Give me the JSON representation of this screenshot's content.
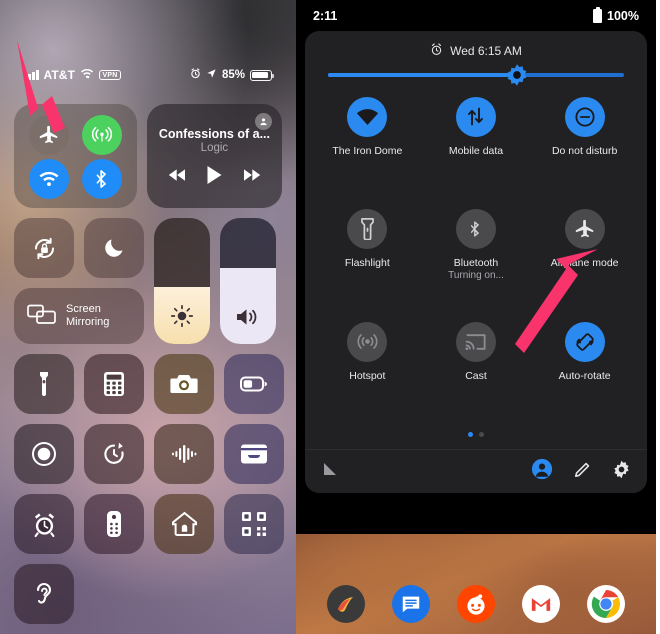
{
  "ios": {
    "status": {
      "carrier": "AT&T",
      "vpn_badge": "VPN",
      "battery_percent": "85%",
      "icons": [
        "signal-bars-icon",
        "wifi-icon",
        "vpn-badge",
        "alarm-icon",
        "location-arrow-icon",
        "battery-icon"
      ]
    },
    "connectivity": {
      "airplane_label": "airplane-mode-icon",
      "cellular_label": "cellular-data-icon",
      "wifi_label": "wifi-icon",
      "bluetooth_label": "bluetooth-icon"
    },
    "media": {
      "title": "Confessions of a...",
      "artist": "Logic",
      "airplay": "airplay-icon",
      "controls": [
        "rewind-icon",
        "play-icon",
        "fast-forward-icon"
      ]
    },
    "toggles": {
      "rotation_lock": "rotation-lock-icon",
      "do_not_disturb": "moon-icon",
      "screen_mirroring_line1": "Screen",
      "screen_mirroring_line2": "Mirroring"
    },
    "sliders": {
      "brightness_icon": "brightness-icon",
      "brightness_percent": 45,
      "volume_icon": "volume-icon",
      "volume_percent": 60
    },
    "grid_tiles": [
      {
        "name": "flashlight-icon"
      },
      {
        "name": "calculator-icon"
      },
      {
        "name": "camera-icon"
      },
      {
        "name": "low-power-mode-icon"
      },
      {
        "name": "screen-record-icon"
      },
      {
        "name": "timer-icon"
      },
      {
        "name": "sound-recognition-icon"
      },
      {
        "name": "wallet-icon"
      },
      {
        "name": "alarm-clock-icon"
      },
      {
        "name": "remote-icon"
      },
      {
        "name": "home-icon"
      },
      {
        "name": "qr-code-icon"
      },
      {
        "name": "hearing-icon"
      }
    ]
  },
  "android": {
    "status": {
      "time": "2:11",
      "battery_percent": "100%"
    },
    "alarm": {
      "icon": "alarm-icon",
      "text": "Wed 6:15 AM"
    },
    "brightness": {
      "icon": "brightness-icon",
      "percent": 64
    },
    "tiles": [
      {
        "label": "The Iron Dome",
        "sub": "",
        "icon": "wifi-icon",
        "state": "on"
      },
      {
        "label": "Mobile data",
        "sub": "",
        "icon": "mobile-data-icon",
        "state": "on"
      },
      {
        "label": "Do not disturb",
        "sub": "",
        "icon": "do-not-disturb-icon",
        "state": "on"
      },
      {
        "label": "Flashlight",
        "sub": "",
        "icon": "flashlight-icon",
        "state": "off"
      },
      {
        "label": "Bluetooth",
        "sub": "Turning on...",
        "icon": "bluetooth-icon",
        "state": "off"
      },
      {
        "label": "Airplane mode",
        "sub": "",
        "icon": "airplane-mode-icon",
        "state": "off"
      },
      {
        "label": "Hotspot",
        "sub": "",
        "icon": "hotspot-icon",
        "state": "dim"
      },
      {
        "label": "Cast",
        "sub": "",
        "icon": "cast-icon",
        "state": "dim"
      },
      {
        "label": "Auto-rotate",
        "sub": "",
        "icon": "auto-rotate-icon",
        "state": "on"
      }
    ],
    "pager": {
      "pages": 2,
      "active": 0
    },
    "footer": {
      "signal": "signal-triangle-icon",
      "user": "user-avatar-icon",
      "edit": "edit-pencil-icon",
      "settings": "gear-icon"
    },
    "dock": [
      {
        "name": "gallery-app-icon",
        "color": "#3a3a3a"
      },
      {
        "name": "messages-app-icon",
        "color": "#1a73e8"
      },
      {
        "name": "reddit-app-icon",
        "color": "#ff4500"
      },
      {
        "name": "gmail-app-icon",
        "color": "#ffffff"
      },
      {
        "name": "chrome-app-icon",
        "color": "#ffffff"
      }
    ]
  },
  "annotations": {
    "arrow_color": "#f9336b",
    "left_arrow_target": "ios-airplane-mode-toggle",
    "right_arrow_target": "android-airplane-mode-tile"
  }
}
